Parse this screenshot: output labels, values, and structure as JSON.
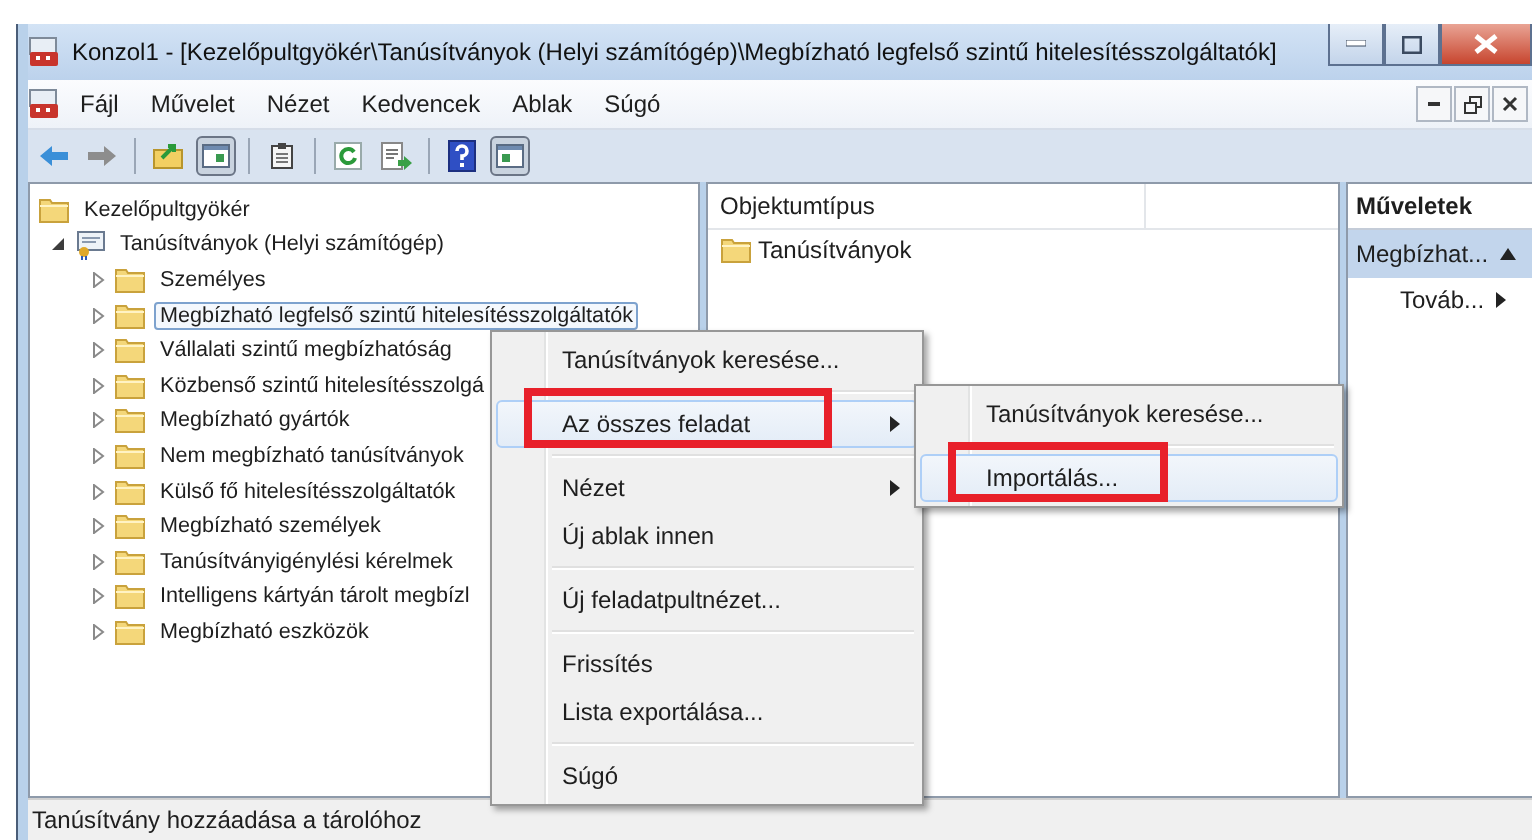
{
  "window": {
    "title": "Konzol1 - [Kezelőpultgyökér\\Tanúsítványok (Helyi számítógép)\\Megbízható legfelső szintű hitelesítésszolgáltatók]"
  },
  "menu": {
    "items": [
      "Fájl",
      "Művelet",
      "Nézet",
      "Kedvencek",
      "Ablak",
      "Súgó"
    ]
  },
  "tree": {
    "label": "Kezelőpultgyökér",
    "children": [
      {
        "label": "Tanúsítványok (Helyi számítógép)",
        "expanded": true,
        "children": [
          {
            "label": "Személyes",
            "expanded": false,
            "selected": false
          },
          {
            "label": "Megbízható legfelső szintű hitelesítésszolgáltatók",
            "expanded": false,
            "selected": true
          },
          {
            "label": "Vállalati szintű megbízhatóság",
            "expanded": false,
            "selected": false
          },
          {
            "label": "Közbenső szintű hitelesítésszolgá",
            "expanded": false,
            "selected": false
          },
          {
            "label": "Megbízható gyártók",
            "expanded": false,
            "selected": false
          },
          {
            "label": "Nem megbízható tanúsítványok",
            "expanded": false,
            "selected": false
          },
          {
            "label": "Külső fő hitelesítésszolgáltatók",
            "expanded": false,
            "selected": false
          },
          {
            "label": "Megbízható személyek",
            "expanded": false,
            "selected": false
          },
          {
            "label": "Tanúsítványigénylési kérelmek",
            "expanded": false,
            "selected": false
          },
          {
            "label": "Intelligens kártyán tárolt megbízl",
            "expanded": false,
            "selected": false
          },
          {
            "label": "Megbízható eszközök",
            "expanded": false,
            "selected": false
          }
        ]
      }
    ]
  },
  "list": {
    "columns": [
      "Objektumtípus"
    ],
    "rows": [
      "Tanúsítványok"
    ]
  },
  "actions": {
    "title": "Műveletek",
    "section": {
      "label": "Megbízhat...",
      "expanded": true
    },
    "items": [
      "Továb..."
    ]
  },
  "context_menu": {
    "groups": [
      [
        {
          "label": "Tanúsítványok keresése...",
          "selected": false,
          "submenu": false,
          "highlighted": false
        }
      ],
      [
        {
          "label": "Az összes feladat",
          "selected": true,
          "submenu": true,
          "highlighted": true
        }
      ],
      [
        {
          "label": "Nézet",
          "selected": false,
          "submenu": true,
          "highlighted": false
        },
        {
          "label": "Új ablak innen",
          "selected": false,
          "submenu": false,
          "highlighted": false
        }
      ],
      [
        {
          "label": "Új feladatpultnézet...",
          "selected": false,
          "submenu": false,
          "highlighted": false
        }
      ],
      [
        {
          "label": "Frissítés",
          "selected": false,
          "submenu": false,
          "highlighted": false
        },
        {
          "label": "Lista exportálása...",
          "selected": false,
          "submenu": false,
          "highlighted": false
        }
      ],
      [
        {
          "label": "Súgó",
          "selected": false,
          "submenu": false,
          "highlighted": false
        }
      ]
    ]
  },
  "submenu": {
    "groups": [
      [
        {
          "label": "Tanúsítványok keresése...",
          "selected": false,
          "highlighted": false
        }
      ],
      [
        {
          "label": "Importálás...",
          "selected": true,
          "highlighted": true
        }
      ]
    ]
  },
  "status_bar": {
    "text": "Tanúsítvány hozzáadása a tárolóhoz"
  }
}
